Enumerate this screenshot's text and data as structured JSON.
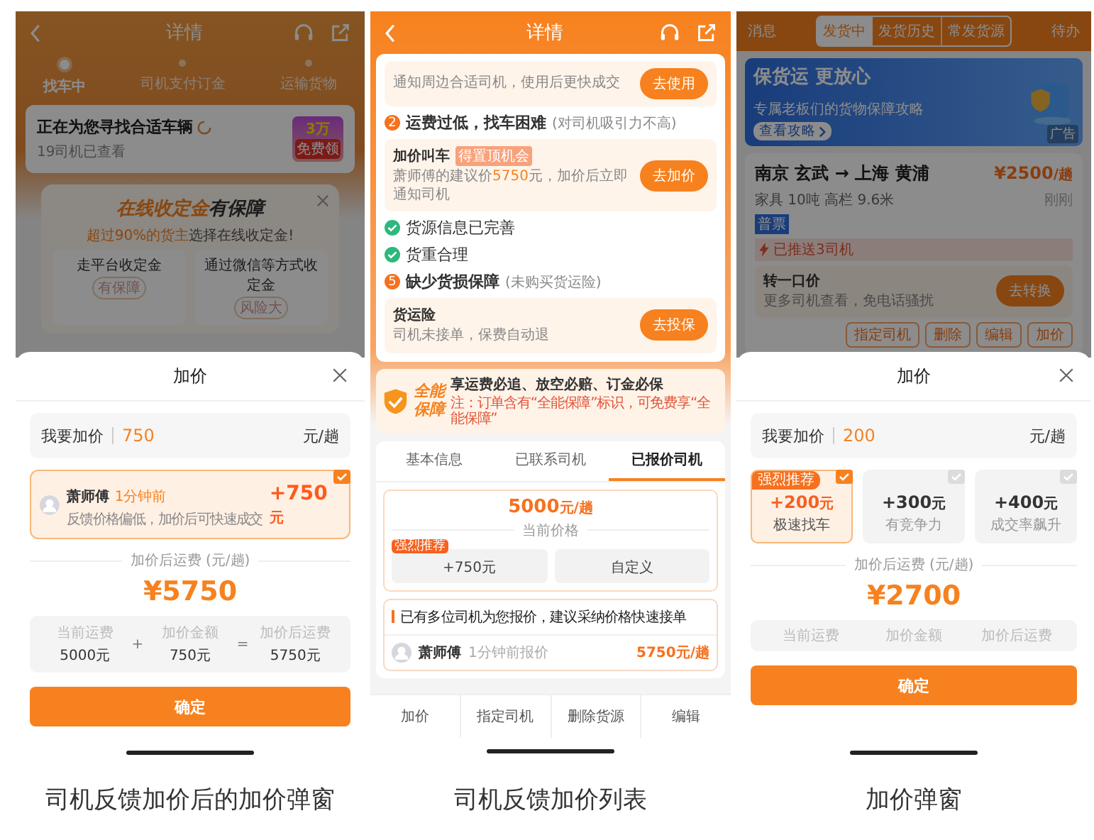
{
  "left": {
    "background": {
      "header": {
        "title": "详情"
      },
      "steps": [
        {
          "label": "找车中",
          "selected": true
        },
        {
          "label": "司机支付订金",
          "selected": false
        },
        {
          "label": "运输货物",
          "selected": false
        }
      ],
      "status_card": {
        "title": "正在为您寻找合适车辆",
        "subtitle": "19司机已查看",
        "promo": [
          "3万",
          "免费领"
        ]
      },
      "popup": {
        "title_highlight": "在线收定金",
        "title_rest": "有保障",
        "subtitle_highlight": "超过90%的货主",
        "subtitle_rest": "选择在线收定金!",
        "options": [
          {
            "label": "走平台收定金",
            "stamp": "有保障"
          },
          {
            "label": "通过微信等方式收定金",
            "stamp": "风险大"
          }
        ]
      }
    },
    "sheet": {
      "title": "加价",
      "input": {
        "label": "我要加价",
        "value": "750",
        "unit": "元/趟"
      },
      "driver": {
        "name": "萧师傅",
        "time": "1分钟前",
        "note": "反馈价格偏低，加价后可快速成交",
        "amount": "+750",
        "unit": "元",
        "checked": true
      },
      "total_label": "加价后运费 (元/趟)",
      "total": "¥5750",
      "breakdown": [
        {
          "label": "当前运费",
          "value": "5000元"
        },
        {
          "label": "加价金额",
          "value": "750元"
        },
        {
          "label": "加价后运费",
          "value": "5750元"
        }
      ],
      "operators": [
        "+",
        "="
      ],
      "confirm": "确定"
    },
    "caption": "司机反馈加价后的加价弹窗"
  },
  "middle": {
    "header": {
      "title": "详情"
    },
    "top_tip": {
      "text": "通知周边合适司机，使用后更快成交",
      "button": "去使用"
    },
    "checks": [
      {
        "kind": "issue",
        "number": "2",
        "title": "运费过低，找车困难",
        "note": "(对司机吸引力不高)",
        "action": {
          "title": "加价叫车",
          "tag": "得置顶机会",
          "desc": [
            {
              "text": "萧师傅的建议价",
              "highlight": false
            },
            {
              "text": "5750",
              "highlight": true
            },
            {
              "text": "元，加价后立即通知司机",
              "highlight": false
            }
          ],
          "button": "去加价"
        }
      },
      {
        "kind": "ok",
        "title": "货源信息已完善"
      },
      {
        "kind": "ok",
        "title": "货重合理"
      },
      {
        "kind": "issue",
        "number": "5",
        "title": "缺少货损保障",
        "note": "(未购买货运险)",
        "action": {
          "title": "货运险",
          "desc": [
            {
              "text": "司机未接单，保费自动退",
              "highlight": false
            }
          ],
          "button": "去投保"
        }
      }
    ],
    "guarantee": {
      "badge": [
        "全能",
        "保障"
      ],
      "headline": "享运费必追、放空必赔、订金必保",
      "note": "注：订单含有“全能保障”标识，可免费享“全能保障”"
    },
    "tabs": [
      {
        "label": "基本信息",
        "selected": false
      },
      {
        "label": "已联系司机",
        "selected": false
      },
      {
        "label": "已报价司机",
        "selected": true
      }
    ],
    "price": {
      "amount": "5000",
      "unit": "元/趟",
      "label": "当前价格",
      "options": [
        {
          "label": "+750元",
          "tag": "强烈推荐"
        },
        {
          "label": "自定义"
        }
      ]
    },
    "quotes": {
      "notice": "已有多位司机为您报价，建议采纳价格快速接单",
      "rows": [
        {
          "name": "萧师傅",
          "time": "1分钟前报价",
          "price": "5750元/趟"
        }
      ]
    },
    "bottom_actions": [
      "加价",
      "指定司机",
      "删除货源",
      "编辑"
    ],
    "caption": "司机反馈加价列表"
  },
  "right": {
    "background": {
      "top_tabs": {
        "left": "消息",
        "segments": [
          {
            "label": "发货中",
            "selected": true
          },
          {
            "label": "发货历史",
            "selected": false
          },
          {
            "label": "常发货源",
            "selected": false
          }
        ],
        "right": "待办"
      },
      "banner": {
        "title": "保货运 更放心",
        "subtitle": "专属老板们的货物保障攻略",
        "link": "查看攻略",
        "ad": "广告"
      },
      "order": {
        "route": "南京 玄武 → 上海 黄浦",
        "price": "¥2500",
        "price_unit": "/趟",
        "cargo": "家具 10吨 高栏 9.6米",
        "time": "刚刚",
        "tag": "普票",
        "pushed": "已推送3司机",
        "offer": {
          "title": "转一口价",
          "desc": "更多司机查看，免电话骚扰",
          "button": "去转换"
        },
        "actions": [
          "指定司机",
          "删除",
          "编辑",
          "加价"
        ]
      }
    },
    "sheet": {
      "title": "加价",
      "input": {
        "label": "我要加价",
        "value": "200",
        "unit": "元/趟"
      },
      "options": [
        {
          "amount": "+200",
          "unit": "元",
          "note": "极速找车",
          "selected": true,
          "tag": "强烈推荐"
        },
        {
          "amount": "+300",
          "unit": "元",
          "note": "有竞争力",
          "selected": false
        },
        {
          "amount": "+400",
          "unit": "元",
          "note": "成交率飙升",
          "selected": false
        }
      ],
      "total_label": "加价后运费 (元/趟)",
      "total": "¥2700",
      "breakdown": [
        {
          "label": "当前运费"
        },
        {
          "label": "加价金额"
        },
        {
          "label": "加价后运费"
        }
      ],
      "confirm": "确定"
    },
    "caption": "加价弹窗"
  }
}
